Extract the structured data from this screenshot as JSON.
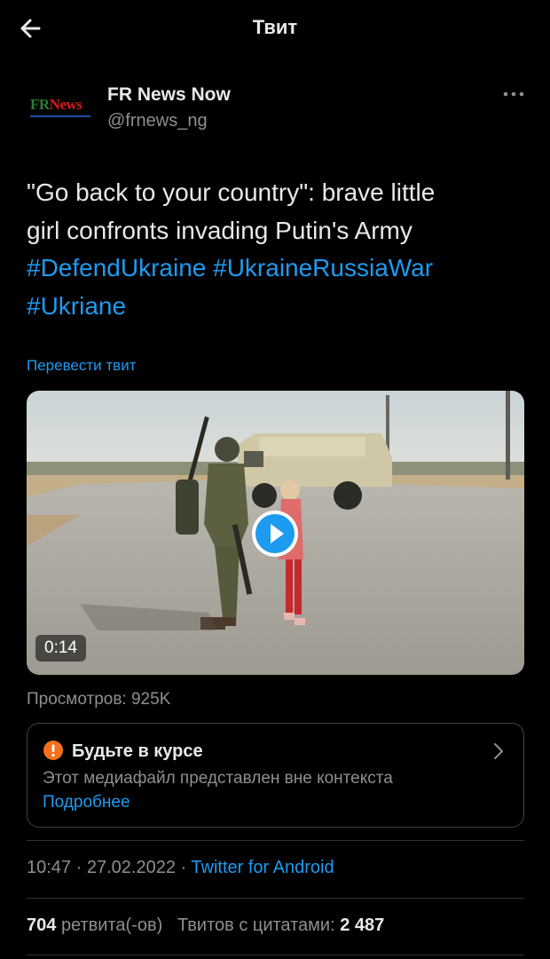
{
  "header": {
    "title": "Твит",
    "back_icon": "back-arrow-icon"
  },
  "author": {
    "name": "FR News Now",
    "handle": "@frnews_ng",
    "avatar_logo": "FRNews",
    "avatar_colors": {
      "fr": "#2e7d32",
      "news": "#d81b1b",
      "bar": "#1d4fa6"
    }
  },
  "tweet": {
    "text_lines": [
      "\"Go back to your country\":  brave little",
      "girl confronts invading Putin's Army"
    ],
    "hashtags": [
      "#DefendUkraine",
      "#UkraineRussiaWar",
      "#Ukriane"
    ],
    "translate_label": "Перевести твит"
  },
  "media": {
    "duration": "0:14",
    "play_icon": "play-icon"
  },
  "views": "Просмотров: 925K",
  "notice": {
    "icon": "exclamation-circle-icon",
    "title": "Будьте в курсе",
    "body": "Этот медиафайл представлен вне контекста",
    "link": "Подробнее"
  },
  "meta": {
    "time": "10:47",
    "separator": "·",
    "date": "27.02.2022",
    "client": "Twitter for Android"
  },
  "stats": {
    "retweets_count": "704",
    "retweets_label": "ретвита(-ов)",
    "quotes_label": "Твитов с цитатами:",
    "quotes_count": "2 487"
  },
  "colors": {
    "background": "#000000",
    "text": "#e7e9ea",
    "secondary": "#8b8f94",
    "accent": "#1d9bf0",
    "warning": "#f4711c",
    "border": "#3e4144"
  }
}
